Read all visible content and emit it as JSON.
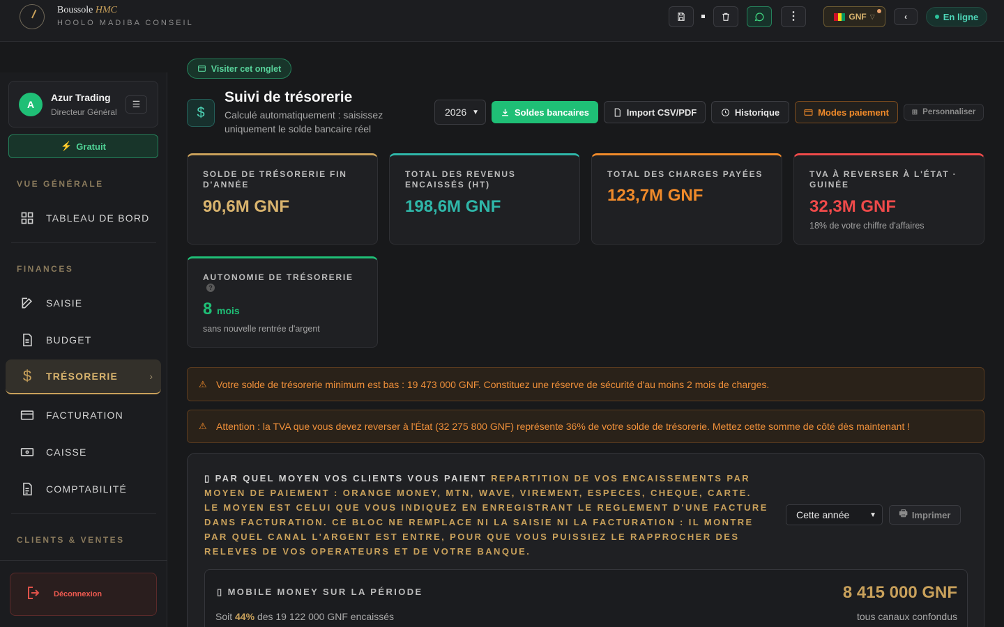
{
  "header": {
    "brand_name": "Boussole",
    "brand_suffix": "HMC",
    "brand_sub": "HOOLO MADIBA CONSEIL",
    "currency": "GNF",
    "status": "En ligne"
  },
  "sidebar": {
    "user": {
      "initial": "A",
      "name": "Azur Trading",
      "role": "Directeur Général"
    },
    "plan": "Gratuit",
    "sections": {
      "vue": "VUE GÉNÉRALE",
      "finances": "FINANCES",
      "clients": "CLIENTS & VENTES"
    },
    "items": {
      "dashboard": "TABLEAU DE BORD",
      "saisie": "SAISIE",
      "budget": "BUDGET",
      "tresorerie": "TRÉSORERIE",
      "facturation": "FACTURATION",
      "caisse": "CAISSE",
      "comptabilite": "COMPTABILITÉ"
    },
    "logout": "Déconnexion"
  },
  "main": {
    "visit": "Visiter cet onglet",
    "title": "Suivi de trésorerie",
    "subtitle": "Calculé automatiquement : saisissez uniquement le solde bancaire réel",
    "year": "2026",
    "actions": {
      "soldes": "Soldes bancaires",
      "import": "Import CSV/PDF",
      "historique": "Historique",
      "modes": "Modes paiement",
      "personnaliser": "Personnaliser"
    },
    "kpis": [
      {
        "label": "SOLDE DE TRÉSORERIE FIN D'ANNÉE",
        "value": "90,6M GNF",
        "color": "#d9b46e"
      },
      {
        "label": "TOTAL DES REVENUS ENCAISSÉS (HT)",
        "value": "198,6M GNF",
        "color": "#2fb7a9"
      },
      {
        "label": "TOTAL DES CHARGES PAYÉES",
        "value": "123,7M GNF",
        "color": "#f08a2a"
      },
      {
        "label": "TVA À REVERSER À L'ÉTAT · GUINÉE",
        "value": "32,3M GNF",
        "note": "18% de votre chiffre d'affaires",
        "color": "#ef4a4a"
      }
    ],
    "autonomy": {
      "label": "AUTONOMIE DE TRÉSORERIE",
      "value": "8",
      "unit": "mois",
      "note": "sans nouvelle rentrée d'argent",
      "color": "#1fbf76"
    },
    "alerts": [
      "Votre solde de trésorerie minimum est bas : 19 473 000 GNF. Constituez une réserve de sécurité d'au moins 2 mois de charges.",
      "Attention : la TVA que vous devez reverser à l'État (32 275 800 GNF) représente 36% de votre solde de trésorerie. Mettez cette somme de côté dès maintenant !"
    ],
    "payments": {
      "heading": "PAR QUEL MOYEN VOS CLIENTS VOUS PAIENT",
      "description": "REPARTITION DE VOS ENCAISSEMENTS PAR MOYEN DE PAIEMENT : ORANGE MONEY, MTN, WAVE, VIREMENT, ESPECES, CHEQUE, CARTE. LE MOYEN EST CELUI QUE VOUS INDIQUEZ EN ENREGISTRANT LE REGLEMENT D'UNE FACTURE DANS FACTURATION. CE BLOC NE REMPLACE NI LA SAISIE NI LA FACTURATION : IL MONTRE PAR QUEL CANAL L'ARGENT EST ENTRE, POUR QUE VOUS PUISSIEZ LE RAPPROCHER DES RELEVES DE VOS OPERATEURS ET DE VOTRE BANQUE.",
      "period": "Cette année",
      "print": "Imprimer",
      "mobile_title": "MOBILE MONEY SUR LA PÉRIODE",
      "mobile_value": "8 415 000 GNF",
      "mobile_pct": "44%",
      "mobile_sub_prefix": "Soit",
      "mobile_sub_suffix": "des 19 122 000 GNF encaissés",
      "mobile_note": "tous canaux confondus"
    }
  }
}
